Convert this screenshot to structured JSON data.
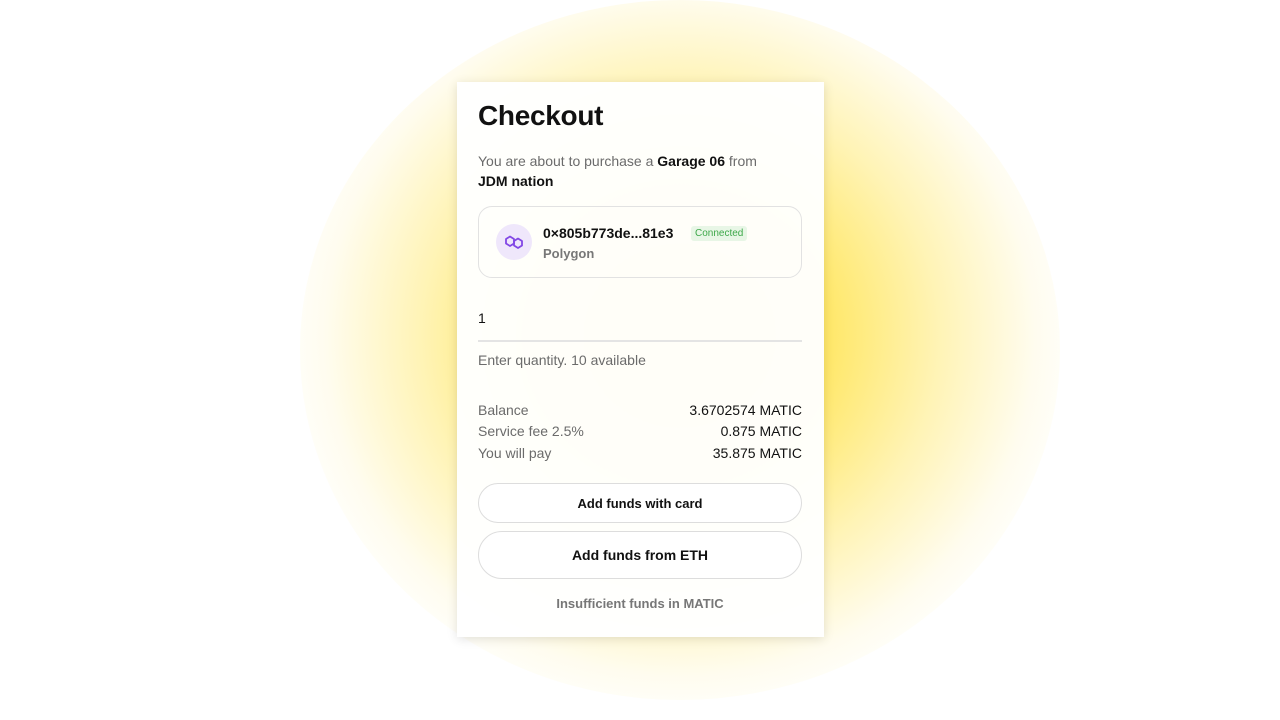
{
  "checkout": {
    "title": "Checkout",
    "intro_prefix": "You are about to purchase a",
    "item_name": "Garage 06",
    "intro_mid": "from",
    "seller": "JDM nation"
  },
  "wallet": {
    "address": "0×805b773de...81e3",
    "status": "Connected",
    "network": "Polygon",
    "icon": "polygon-logo-icon",
    "accent_color": "#8247e5"
  },
  "quantity": {
    "value": "1",
    "hint": "Enter quantity. 10 available"
  },
  "summary": [
    {
      "label": "Balance",
      "value": "3.6702574 MATIC"
    },
    {
      "label": "Service fee 2.5%",
      "value": "0.875 MATIC"
    },
    {
      "label": "You will pay",
      "value": "35.875 MATIC"
    }
  ],
  "buttons": {
    "add_funds_card": "Add funds with card",
    "add_funds_eth": "Add funds from ETH"
  },
  "error": "Insufficient funds in MATIC",
  "colors": {
    "glow": "#ffe03c",
    "connected": "#3ea84a"
  }
}
